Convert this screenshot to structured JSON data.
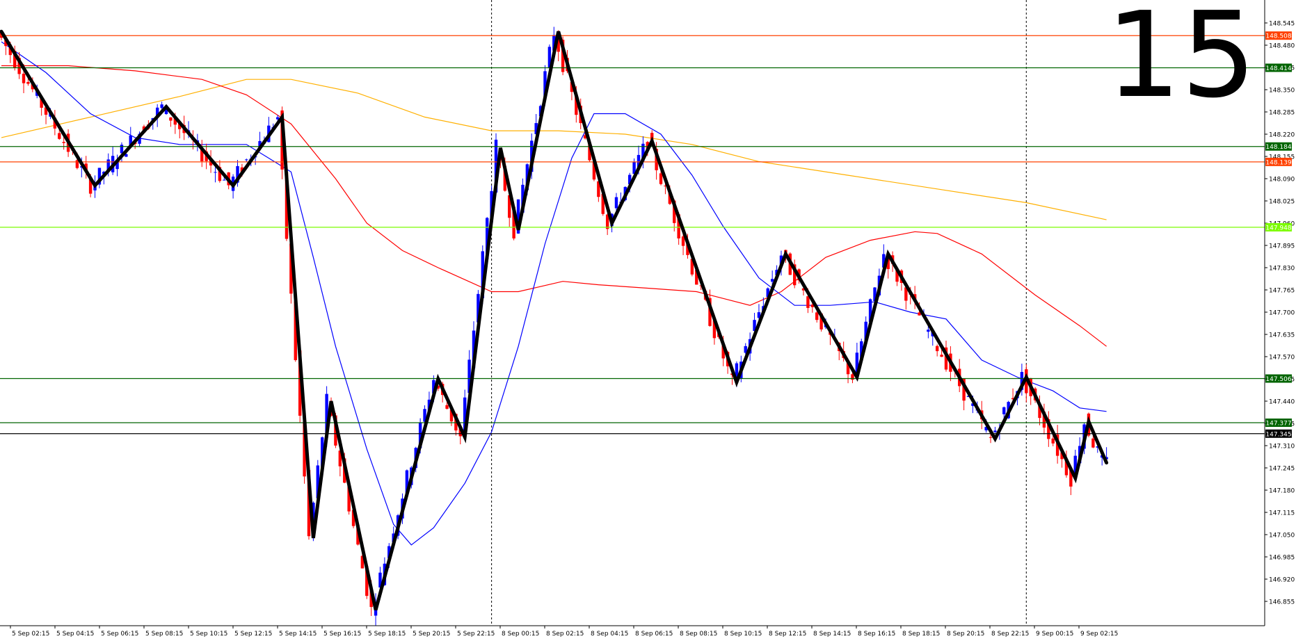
{
  "chart_data": {
    "type": "candlestick",
    "timeframe_label": "15",
    "ylim": [
      146.99,
      148.57
    ],
    "y_ticks": [
      148.545,
      148.48,
      148.415,
      148.35,
      148.285,
      148.22,
      148.155,
      148.09,
      148.025,
      147.96,
      147.895,
      147.83,
      147.765,
      147.7,
      147.635,
      147.57,
      147.505,
      147.44,
      147.375,
      147.31,
      147.245,
      147.18,
      147.115,
      147.05,
      146.985,
      146.92,
      146.855
    ],
    "y_tick_labels": [
      "148.545",
      "148.480",
      "148.415",
      "148.350",
      "148.285",
      "148.220",
      "148.155",
      "148.090",
      "148.025",
      "147.960",
      "147.895",
      "147.830",
      "147.765",
      "147.700",
      "147.635",
      "147.570",
      "147.505",
      "147.440",
      "147.375",
      "147.310",
      "147.245",
      "147.180",
      "147.115",
      "147.050",
      "146.985",
      "146.920",
      "146.855"
    ],
    "x_labels": [
      "5 Sep 02:15",
      "5 Sep 04:15",
      "5 Sep 06:15",
      "5 Sep 08:15",
      "5 Sep 10:15",
      "5 Sep 12:15",
      "5 Sep 14:15",
      "5 Sep 16:15",
      "5 Sep 18:15",
      "5 Sep 20:15",
      "5 Sep 22:15",
      "8 Sep 00:15",
      "8 Sep 02:15",
      "8 Sep 04:15",
      "8 Sep 06:15",
      "8 Sep 08:15",
      "8 Sep 10:15",
      "8 Sep 12:15",
      "8 Sep 14:15",
      "8 Sep 16:15",
      "8 Sep 18:15",
      "8 Sep 20:15",
      "8 Sep 22:15",
      "9 Sep 00:15",
      "9 Sep 02:15"
    ],
    "num_bars": 250,
    "period_separators_at_bar": [
      110,
      230
    ],
    "levels": [
      {
        "price": 148.508,
        "label": "148.508",
        "color": "#ff4000"
      },
      {
        "price": 148.414,
        "label": "148.414",
        "color": "#006400"
      },
      {
        "price": 148.184,
        "label": "148.184",
        "color": "#006400"
      },
      {
        "price": 148.139,
        "label": "148.139",
        "color": "#ff4000"
      },
      {
        "price": 147.948,
        "label": "147.948",
        "color": "#7cfc00"
      },
      {
        "price": 147.506,
        "label": "147.506",
        "color": "#006400"
      },
      {
        "price": 147.377,
        "label": "147.377",
        "color": "#006400"
      },
      {
        "price": 147.345,
        "label": "147.345",
        "color": "#000000"
      }
    ],
    "zigzag": [
      {
        "bar": 0,
        "price": 148.52
      },
      {
        "bar": 21,
        "price": 148.07
      },
      {
        "bar": 37,
        "price": 148.3
      },
      {
        "bar": 52,
        "price": 148.07
      },
      {
        "bar": 63,
        "price": 148.27
      },
      {
        "bar": 70,
        "price": 147.04
      },
      {
        "bar": 74,
        "price": 147.44
      },
      {
        "bar": 84,
        "price": 146.83
      },
      {
        "bar": 98,
        "price": 147.505
      },
      {
        "bar": 104,
        "price": 147.335
      },
      {
        "bar": 112,
        "price": 148.18
      },
      {
        "bar": 116,
        "price": 147.94
      },
      {
        "bar": 125,
        "price": 148.52
      },
      {
        "bar": 137,
        "price": 147.96
      },
      {
        "bar": 146,
        "price": 148.2
      },
      {
        "bar": 165,
        "price": 147.495
      },
      {
        "bar": 176,
        "price": 147.87
      },
      {
        "bar": 192,
        "price": 147.51
      },
      {
        "bar": 199,
        "price": 147.87
      },
      {
        "bar": 223,
        "price": 147.33
      },
      {
        "bar": 230,
        "price": 147.51
      },
      {
        "bar": 241,
        "price": 147.215
      },
      {
        "bar": 244,
        "price": 147.38
      },
      {
        "bar": 248,
        "price": 147.26
      }
    ],
    "ma_fast": [
      {
        "bar": 0,
        "price": 148.49
      },
      {
        "bar": 10,
        "price": 148.4
      },
      {
        "bar": 20,
        "price": 148.28
      },
      {
        "bar": 30,
        "price": 148.21
      },
      {
        "bar": 40,
        "price": 148.19
      },
      {
        "bar": 55,
        "price": 148.19
      },
      {
        "bar": 65,
        "price": 148.11
      },
      {
        "bar": 70,
        "price": 147.86
      },
      {
        "bar": 75,
        "price": 147.6
      },
      {
        "bar": 82,
        "price": 147.3
      },
      {
        "bar": 88,
        "price": 147.08
      },
      {
        "bar": 92,
        "price": 147.02
      },
      {
        "bar": 97,
        "price": 147.07
      },
      {
        "bar": 104,
        "price": 147.2
      },
      {
        "bar": 110,
        "price": 147.35
      },
      {
        "bar": 116,
        "price": 147.6
      },
      {
        "bar": 122,
        "price": 147.9
      },
      {
        "bar": 128,
        "price": 148.15
      },
      {
        "bar": 133,
        "price": 148.28
      },
      {
        "bar": 140,
        "price": 148.28
      },
      {
        "bar": 148,
        "price": 148.22
      },
      {
        "bar": 155,
        "price": 148.1
      },
      {
        "bar": 162,
        "price": 147.95
      },
      {
        "bar": 170,
        "price": 147.8
      },
      {
        "bar": 178,
        "price": 147.72
      },
      {
        "bar": 186,
        "price": 147.72
      },
      {
        "bar": 196,
        "price": 147.73
      },
      {
        "bar": 204,
        "price": 147.7
      },
      {
        "bar": 212,
        "price": 147.68
      },
      {
        "bar": 220,
        "price": 147.56
      },
      {
        "bar": 228,
        "price": 147.51
      },
      {
        "bar": 236,
        "price": 147.47
      },
      {
        "bar": 242,
        "price": 147.42
      },
      {
        "bar": 248,
        "price": 147.41
      }
    ],
    "ma_mid": [
      {
        "bar": 0,
        "price": 148.42
      },
      {
        "bar": 15,
        "price": 148.42
      },
      {
        "bar": 30,
        "price": 148.405
      },
      {
        "bar": 45,
        "price": 148.38
      },
      {
        "bar": 55,
        "price": 148.335
      },
      {
        "bar": 65,
        "price": 148.25
      },
      {
        "bar": 75,
        "price": 148.09
      },
      {
        "bar": 82,
        "price": 147.96
      },
      {
        "bar": 90,
        "price": 147.88
      },
      {
        "bar": 98,
        "price": 147.83
      },
      {
        "bar": 110,
        "price": 147.76
      },
      {
        "bar": 116,
        "price": 147.76
      },
      {
        "bar": 126,
        "price": 147.79
      },
      {
        "bar": 134,
        "price": 147.78
      },
      {
        "bar": 145,
        "price": 147.77
      },
      {
        "bar": 156,
        "price": 147.76
      },
      {
        "bar": 162,
        "price": 147.74
      },
      {
        "bar": 168,
        "price": 147.72
      },
      {
        "bar": 175,
        "price": 147.76
      },
      {
        "bar": 185,
        "price": 147.86
      },
      {
        "bar": 195,
        "price": 147.91
      },
      {
        "bar": 205,
        "price": 147.935
      },
      {
        "bar": 210,
        "price": 147.93
      },
      {
        "bar": 220,
        "price": 147.87
      },
      {
        "bar": 232,
        "price": 147.75
      },
      {
        "bar": 242,
        "price": 147.66
      },
      {
        "bar": 248,
        "price": 147.6
      }
    ],
    "ma_slow": [
      {
        "bar": 0,
        "price": 148.21
      },
      {
        "bar": 20,
        "price": 148.27
      },
      {
        "bar": 40,
        "price": 148.33
      },
      {
        "bar": 55,
        "price": 148.38
      },
      {
        "bar": 65,
        "price": 148.38
      },
      {
        "bar": 80,
        "price": 148.34
      },
      {
        "bar": 95,
        "price": 148.27
      },
      {
        "bar": 110,
        "price": 148.23
      },
      {
        "bar": 125,
        "price": 148.23
      },
      {
        "bar": 140,
        "price": 148.22
      },
      {
        "bar": 155,
        "price": 148.19
      },
      {
        "bar": 170,
        "price": 148.14
      },
      {
        "bar": 190,
        "price": 148.1
      },
      {
        "bar": 210,
        "price": 148.06
      },
      {
        "bar": 230,
        "price": 148.02
      },
      {
        "bar": 248,
        "price": 147.97
      }
    ],
    "colors": {
      "bull_candle": "#0000ff",
      "bear_candle": "#ff0000",
      "zigzag": "#000000",
      "ma_fast": "#0000ff",
      "ma_mid": "#ff0000",
      "ma_slow": "#ffb000",
      "grid_separator": "#000000"
    }
  }
}
